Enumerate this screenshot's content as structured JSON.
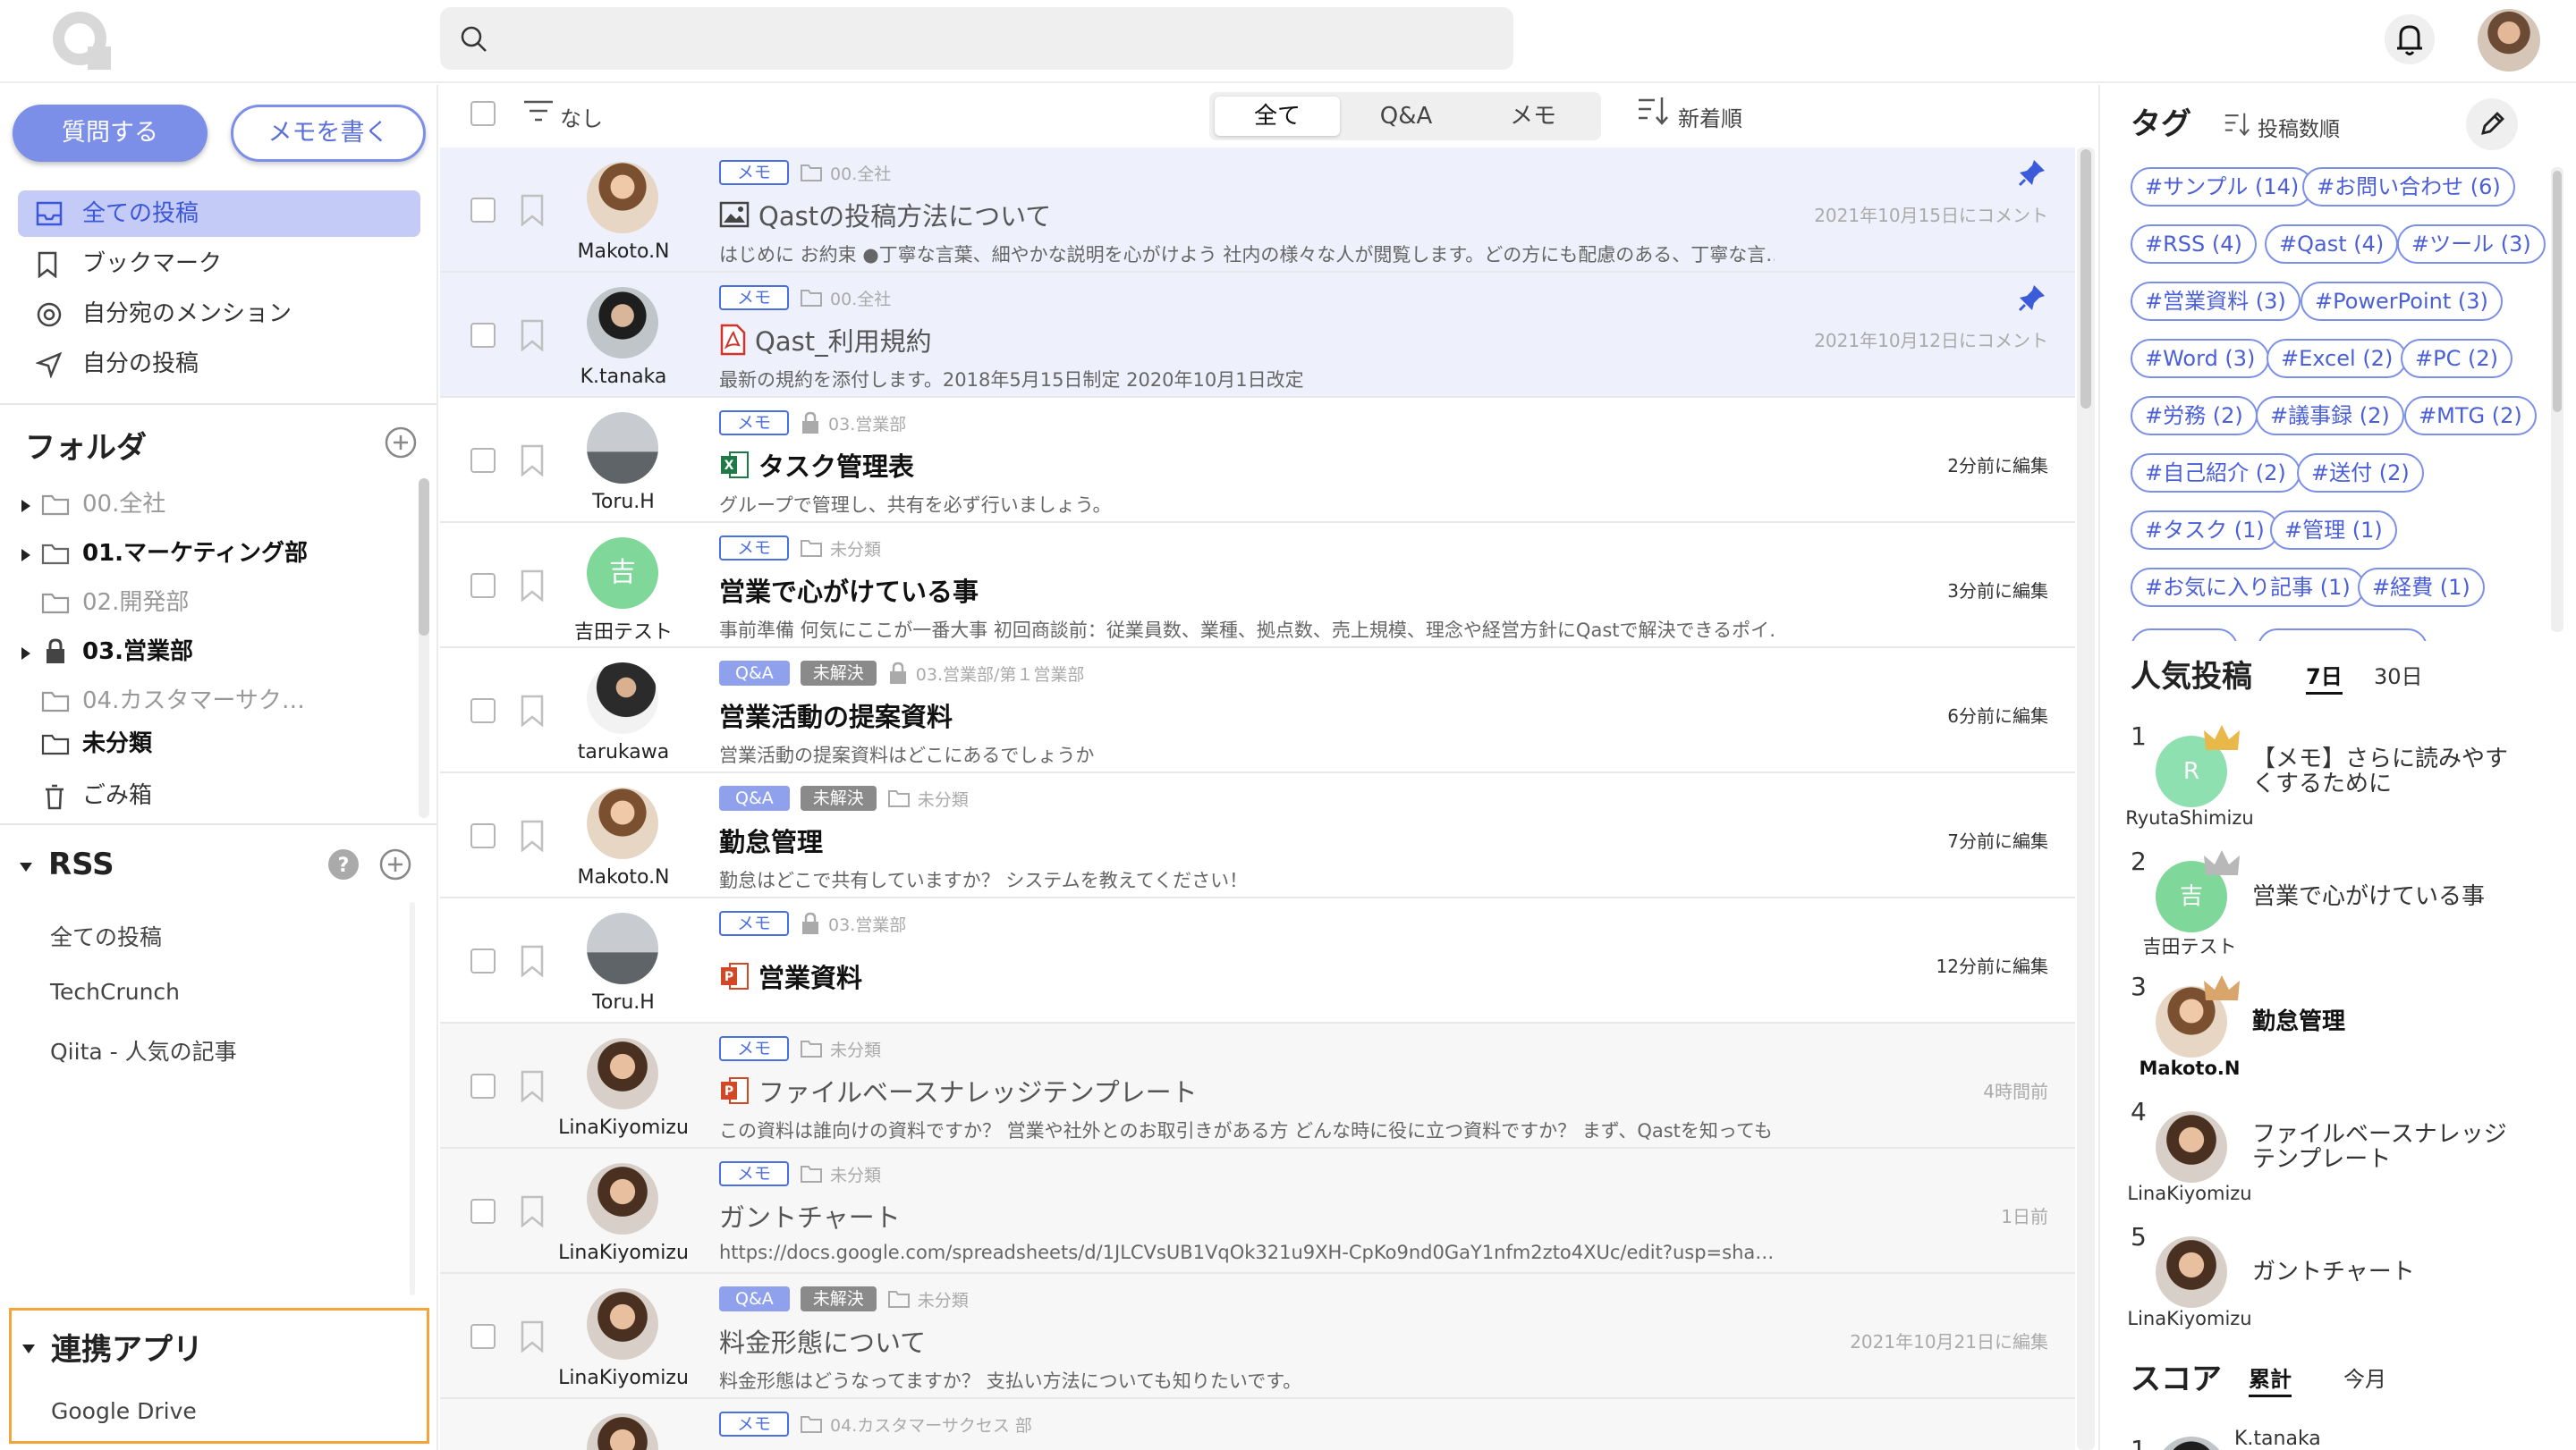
{
  "header": {
    "search_placeholder": ""
  },
  "sidebar": {
    "ask_button": "質問する",
    "memo_button": "メモを書く",
    "nav": [
      {
        "label": "全ての投稿"
      },
      {
        "label": "ブックマーク"
      },
      {
        "label": "自分宛のメンション"
      },
      {
        "label": "自分の投稿"
      }
    ],
    "folder_title": "フォルダ",
    "folders": [
      {
        "label": "00.全社"
      },
      {
        "label": "01.マーケティング部"
      },
      {
        "label": "02.開発部"
      },
      {
        "label": "03.営業部"
      },
      {
        "label": "04.カスタマーサク…"
      },
      {
        "label": "未分類"
      },
      {
        "label": "ごみ箱"
      }
    ],
    "rss_title": "RSS",
    "rss_items": [
      {
        "label": "全ての投稿"
      },
      {
        "label": "TechCrunch"
      },
      {
        "label": "Qiita - 人気の記事"
      }
    ],
    "apps_title": "連携アプリ",
    "apps_items": [
      {
        "label": "Google Drive"
      }
    ]
  },
  "toolbar": {
    "filter_label": "なし",
    "tabs": [
      {
        "label": "全て"
      },
      {
        "label": "Q&A"
      },
      {
        "label": "メモ"
      }
    ],
    "sort_label": "新着順"
  },
  "posts": [
    {
      "user": "Makoto.N",
      "type": "メモ",
      "folder": "00.全社",
      "title": "Qastの投稿方法について",
      "excerpt": "はじめに お約束 ●丁寧な言葉、細やかな説明を心がけよう 社内の様々な人が閲覧します。どの方にも配慮のある、丁寧な言…",
      "meta": "2021年10月15日にコメント"
    },
    {
      "user": "K.tanaka",
      "type": "メモ",
      "folder": "00.全社",
      "title": "Qast_利用規約",
      "excerpt": "最新の規約を添付します。2018年5月15日制定 2020年10月1日改定",
      "meta": "2021年10月12日にコメント"
    },
    {
      "user": "Toru.H",
      "type": "メモ",
      "folder": "03.営業部",
      "title": "タスク管理表",
      "excerpt": "グループで管理し、共有を必ず行いましょう。",
      "meta": "2分前に編集"
    },
    {
      "user": "吉田テスト",
      "avatar_char": "吉",
      "type": "メモ",
      "folder": "未分類",
      "title": "営業で心がけている事",
      "excerpt": "事前準備 何気にここが一番大事 初回商談前：従業員数、業種、拠点数、売上規模、理念や経営方針にQastで解決できるポイ…",
      "meta": "3分前に編集"
    },
    {
      "user": "tarukawa",
      "type": "Q&A",
      "status": "未解決",
      "folder": "03.営業部/第１営業部",
      "title": "営業活動の提案資料",
      "excerpt": "営業活動の提案資料はどこにあるでしょうか",
      "meta": "6分前に編集"
    },
    {
      "user": "Makoto.N",
      "type": "Q&A",
      "status": "未解決",
      "folder": "未分類",
      "title": "勤怠管理",
      "excerpt": "勤怠はどこで共有していますか？ システムを教えてください！",
      "meta": "7分前に編集"
    },
    {
      "user": "Toru.H",
      "type": "メモ",
      "folder": "03.営業部",
      "title": "営業資料",
      "excerpt": "",
      "meta": "12分前に編集"
    },
    {
      "user": "LinaKiyomizu",
      "type": "メモ",
      "folder": "未分類",
      "title": "ファイルベースナレッジテンプレート",
      "excerpt": "この資料は誰向けの資料ですか？ 営業や社外とのお取引きがある方 どんな時に役に立つ資料ですか？ まず、Qastを知っても…",
      "meta": "4時間前"
    },
    {
      "user": "LinaKiyomizu",
      "type": "メモ",
      "folder": "未分類",
      "title": "ガントチャート",
      "excerpt": "https://docs.google.com/spreadsheets/d/1JLCVsUB1VqOk321u9XH-CpKo9nd0GaY1nfm2zto4XUc/edit?usp=sha…",
      "meta": "1日前"
    },
    {
      "user": "LinaKiyomizu",
      "type": "Q&A",
      "status": "未解決",
      "folder": "未分類",
      "title": "料金形態について",
      "excerpt": "料金形態はどうなってますか？ 支払い方法についても知りたいです。",
      "meta": "2021年10月21日に編集"
    },
    {
      "user": "",
      "type": "メモ",
      "folder": "04.カスタマーサクセス 部",
      "title": "",
      "excerpt": "",
      "meta": ""
    }
  ],
  "right": {
    "tag_title": "タグ",
    "tag_sort": "投稿数順",
    "tags": [
      "#サンプル (14)",
      "#お問い合わせ (6)",
      "#RSS (4)",
      "#Qast (4)",
      "#ツール (3)",
      "#営業資料 (3)",
      "#PowerPoint (3)",
      "#Word (3)",
      "#Excel (2)",
      "#PC (2)",
      "#労務 (2)",
      "#議事録 (2)",
      "#MTG (2)",
      "#自己紹介 (2)",
      "#送付 (2)",
      "#タスク (1)",
      "#管理 (1)",
      "#お気に入り記事 (1)",
      "#経費 (1)"
    ],
    "popular_title": "人気投稿",
    "popular_tabs": [
      "7日",
      "30日"
    ],
    "popular": [
      {
        "rank": "1",
        "user": "RyutaShimizu",
        "avatar_char": "R",
        "title": "【メモ】さらに読みやすくするために"
      },
      {
        "rank": "2",
        "user": "吉田テスト",
        "avatar_char": "吉",
        "title": "営業で心がけている事"
      },
      {
        "rank": "3",
        "user": "Makoto.N",
        "title": "勤怠管理"
      },
      {
        "rank": "4",
        "user": "LinaKiyomizu",
        "title": "ファイルベースナレッジテンプレート"
      },
      {
        "rank": "5",
        "user": "LinaKiyomizu",
        "title": "ガントチャート"
      }
    ],
    "score_title": "スコア",
    "score_tabs": [
      "累計",
      "今月"
    ],
    "score_first": {
      "rank": "1",
      "user": "K.tanaka"
    }
  },
  "colors": {
    "accent": "#7c8fe8",
    "highlight": "#f3a53b"
  }
}
